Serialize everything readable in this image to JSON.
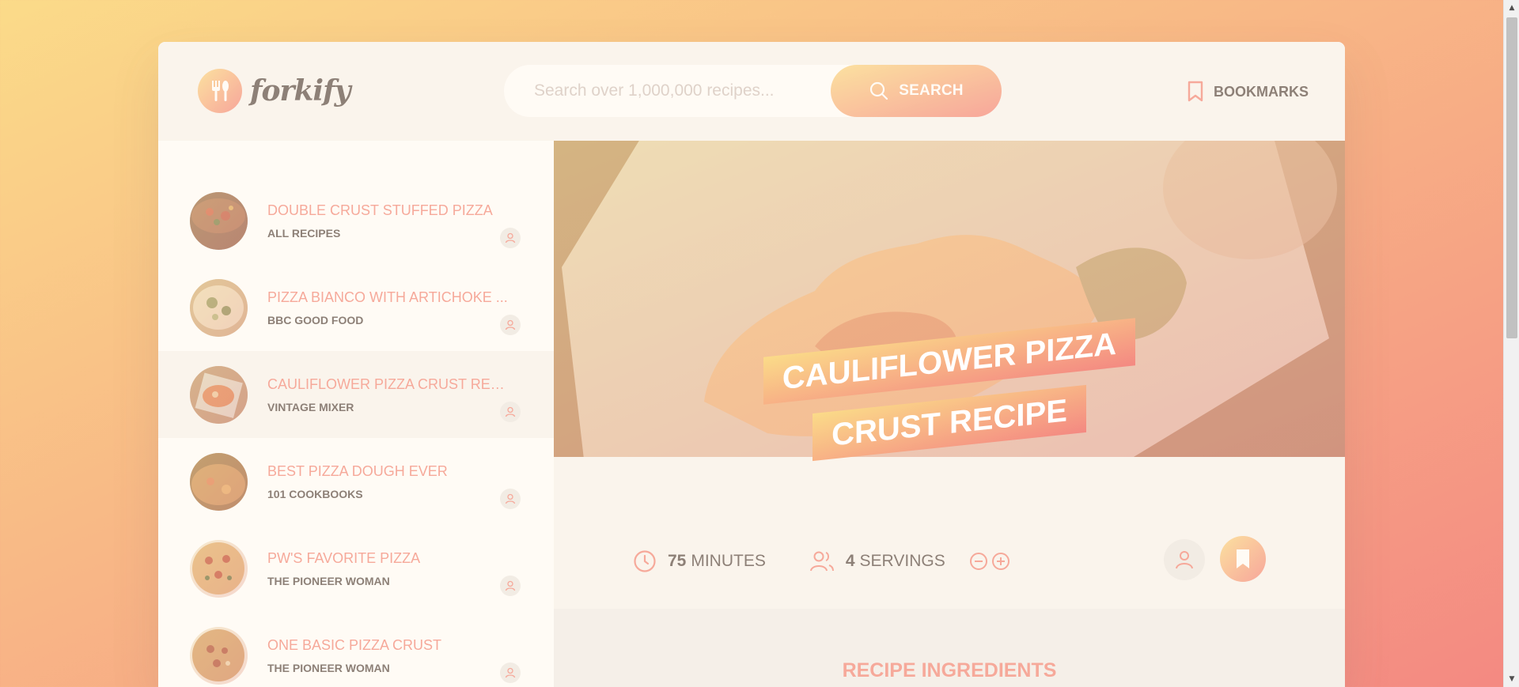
{
  "app": {
    "name": "forkify"
  },
  "search": {
    "placeholder": "Search over 1,000,000 recipes...",
    "button_label": "SEARCH"
  },
  "nav": {
    "bookmarks_label": "BOOKMARKS"
  },
  "results": [
    {
      "title": "DOUBLE CRUST STUFFED PIZZA",
      "publisher": "ALL RECIPES",
      "active": false
    },
    {
      "title": "PIZZA BIANCO WITH ARTICHOKE ...",
      "publisher": "BBC GOOD FOOD",
      "active": false
    },
    {
      "title": "CAULIFLOWER PIZZA CRUST RECI...",
      "publisher": "VINTAGE MIXER",
      "active": true
    },
    {
      "title": "BEST PIZZA DOUGH EVER",
      "publisher": "101 COOKBOOKS",
      "active": false
    },
    {
      "title": "PW'S FAVORITE PIZZA",
      "publisher": "THE PIONEER WOMAN",
      "active": false
    },
    {
      "title": "ONE BASIC PIZZA CRUST",
      "publisher": "THE PIONEER WOMAN",
      "active": false
    }
  ],
  "recipe": {
    "title_line1": "CAULIFLOWER PIZZA",
    "title_line2": "CRUST RECIPE",
    "minutes_value": "75",
    "minutes_label": "MINUTES",
    "servings_value": "4",
    "servings_label": "SERVINGS",
    "ingredients_heading": "RECIPE INGREDIENTS"
  },
  "colors": {
    "accent": "#f38e82",
    "gradient_start": "#fbdb89",
    "gradient_end": "#f48982",
    "text": "#615551"
  }
}
